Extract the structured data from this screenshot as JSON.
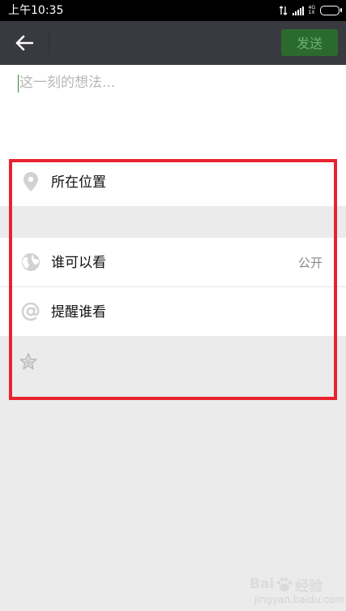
{
  "status_bar": {
    "time": "上午10:35",
    "network_top": "4G",
    "network_bottom": "1X"
  },
  "nav_bar": {
    "send_label": "发送"
  },
  "compose": {
    "placeholder": "这一刻的想法..."
  },
  "options": {
    "location": {
      "label": "所在位置",
      "icon": "location-pin-icon"
    },
    "visibility": {
      "label": "谁可以看",
      "value": "公开",
      "icon": "globe-icon"
    },
    "mention": {
      "label": "提醒谁看",
      "icon": "at-sign-icon"
    },
    "favorite": {
      "icon": "star-icon"
    }
  },
  "watermark": {
    "brand": "Bai",
    "brand_suffix": "经验",
    "url": "jingyan.baidu.com"
  },
  "colors": {
    "status_bar_bg": "#000000",
    "nav_bar_bg": "#393a3f",
    "send_button_bg": "#2a6b2d",
    "send_button_text": "#6fae70",
    "page_bg": "#ebebeb",
    "highlight_border": "#e8232f",
    "icon_gray": "#cfcfcf"
  }
}
